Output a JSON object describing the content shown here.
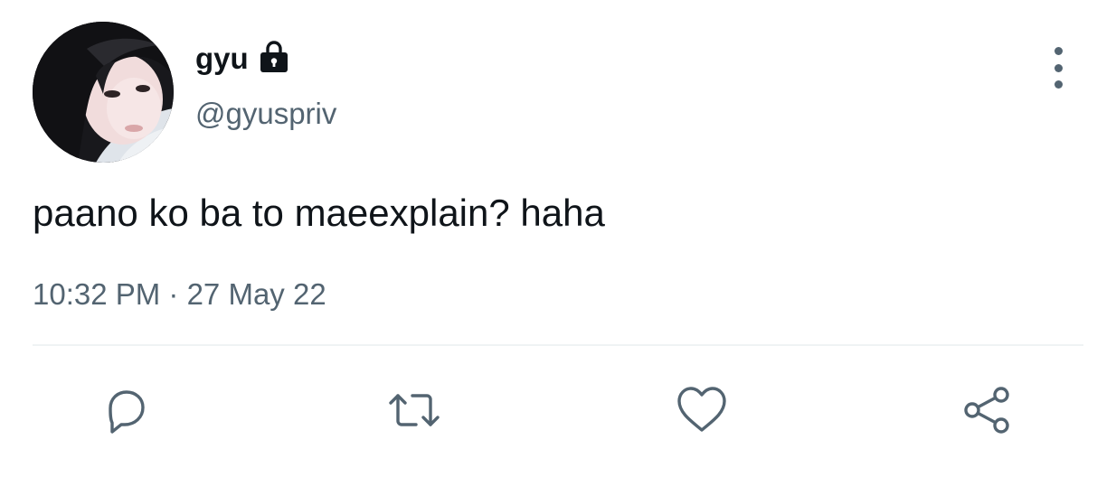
{
  "author": {
    "display_name": "gyu",
    "handle": "@gyuspriv",
    "protected": true,
    "lock_icon": "lock-icon"
  },
  "tweet": {
    "text": "paano ko ba to maeexplain? haha",
    "time": "10:32 PM",
    "separator": " · ",
    "date": "27 May 22"
  },
  "actions": {
    "reply_icon": "reply-icon",
    "retweet_icon": "retweet-icon",
    "like_icon": "heart-icon",
    "share_icon": "share-icon"
  },
  "menu": {
    "icon": "more-vertical-icon"
  },
  "colors": {
    "text_primary": "#0f1419",
    "text_secondary": "#536471",
    "divider": "#eff3f4"
  }
}
